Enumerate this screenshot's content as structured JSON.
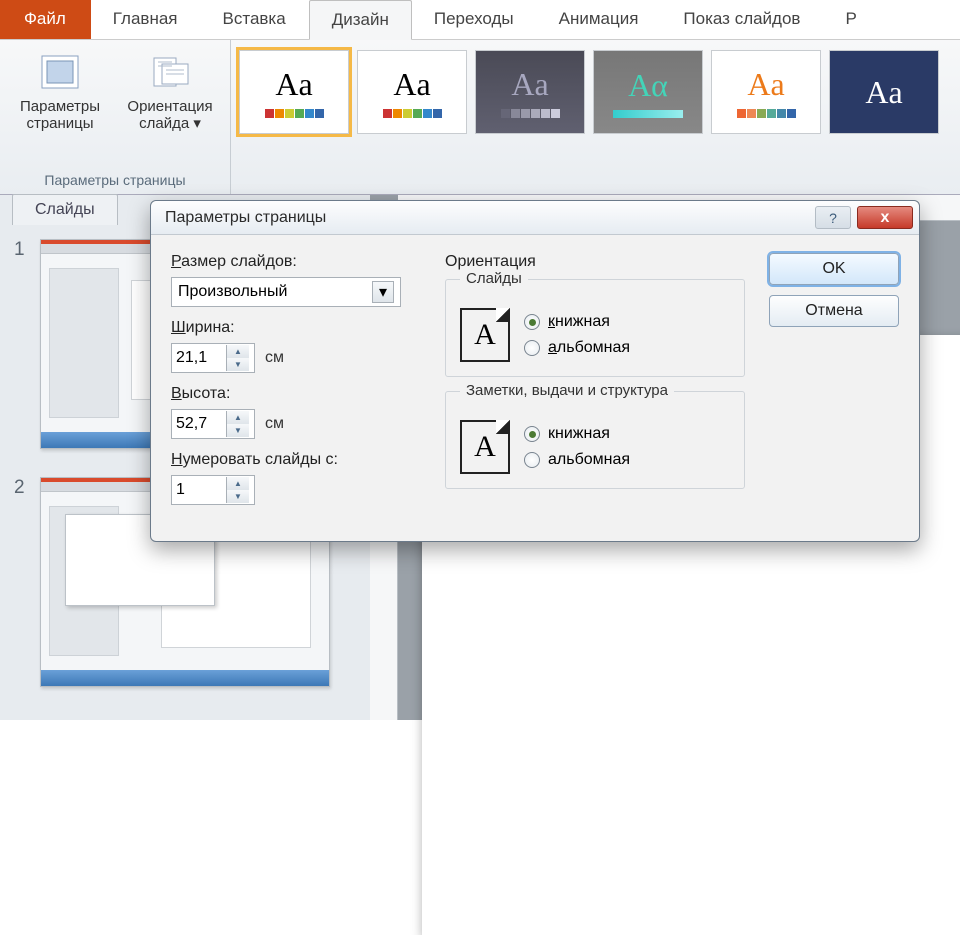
{
  "tabs": {
    "file": "Файл",
    "home": "Главная",
    "insert": "Вставка",
    "design": "Дизайн",
    "transitions": "Переходы",
    "animation": "Анимация",
    "slideshow": "Показ слайдов",
    "truncated": "Р"
  },
  "ribbon": {
    "page_setup_btn": "Параметры\nстраницы",
    "orientation_btn": "Ориентация\nслайда ▾",
    "group_label": "Параметры страницы"
  },
  "side_tab": "Слайды",
  "slides": {
    "n1": "1",
    "n2": "2"
  },
  "dialog": {
    "title": "Параметры страницы",
    "size_label": "Размер слайдов:",
    "size_value": "Произвольный",
    "width_label": "Ширина:",
    "width_value": "21,1",
    "height_label": "Высота:",
    "height_value": "52,7",
    "unit": "см",
    "number_from_label": "Нумеровать слайды с:",
    "number_from_value": "1",
    "orientation_heading": "Ориентация",
    "slides_legend": "Слайды",
    "notes_legend": "Заметки, выдачи и структура",
    "portrait": "книжная",
    "landscape": "альбомная",
    "ok": "OK",
    "cancel": "Отмена",
    "help": "?",
    "close": "x"
  }
}
